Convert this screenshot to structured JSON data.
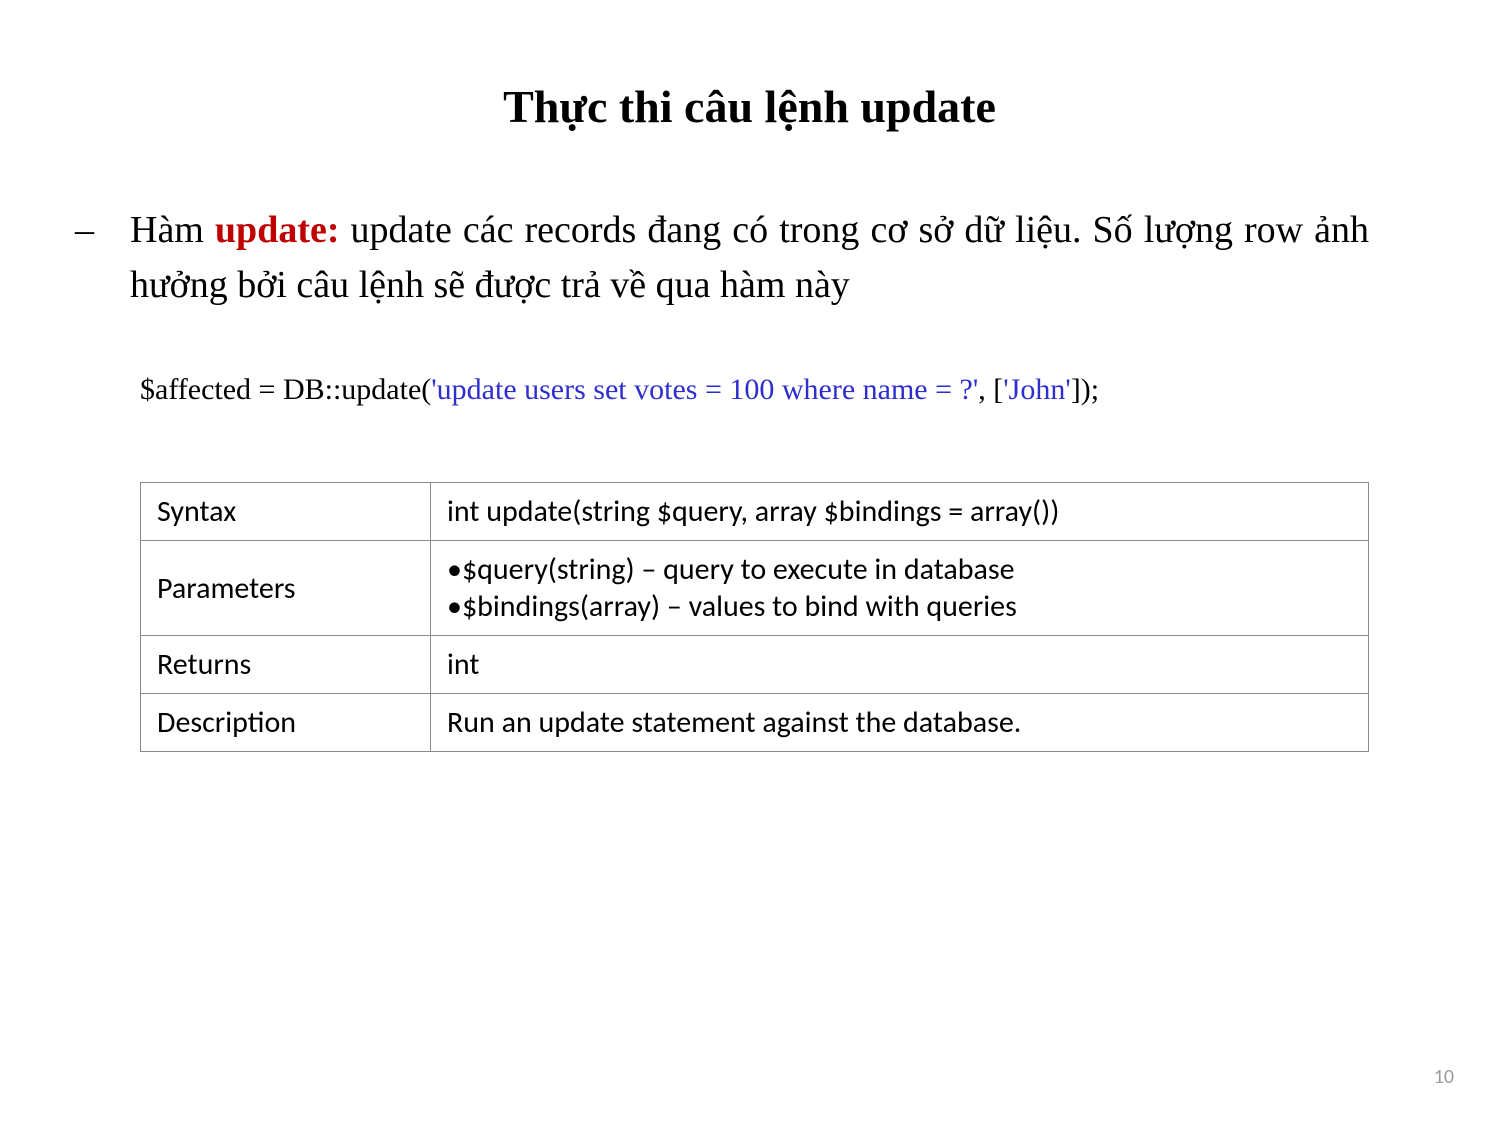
{
  "title": "Thực thi câu lệnh update",
  "body": {
    "dash": "–",
    "prefix": "Hàm ",
    "keyword": "update:",
    "rest": " update các records đang có trong cơ sở dữ liệu. Số lượng row ảnh hưởng bởi câu lệnh sẽ được trả về qua hàm này"
  },
  "code": {
    "part1": "$affected = DB::update(",
    "part2": "'update users set votes = 100 where name = ?'",
    "part3": ", [",
    "part4": "'John'",
    "part5": "]);"
  },
  "table": {
    "rows": [
      {
        "label": "Syntax",
        "value": "int update(string $query, array $bindings = array())"
      },
      {
        "label": "Parameters",
        "value_lines": [
          "•$query(string) – query to execute in database",
          "•$bindings(array) – values to bind with queries"
        ]
      },
      {
        "label": "Returns",
        "value": "int"
      },
      {
        "label": "Description",
        "value": "Run an update statement against the database."
      }
    ]
  },
  "page_number": "10"
}
